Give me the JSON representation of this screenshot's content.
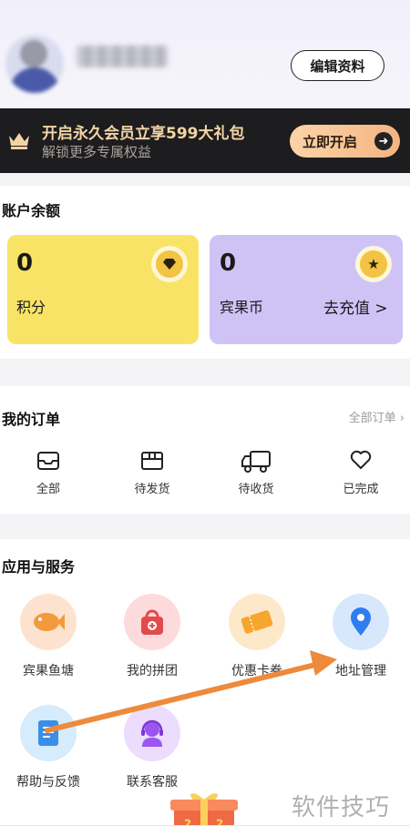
{
  "profile": {
    "edit_label": "编辑资料"
  },
  "vip": {
    "title": "开启永久会员立享599大礼包",
    "subtitle": "解锁更多专属权益",
    "cta": "立即开启"
  },
  "balance": {
    "title": "账户余额",
    "points": {
      "value": "0",
      "label": "积分"
    },
    "coins": {
      "value": "0",
      "label": "宾果币",
      "action": "去充值 >"
    }
  },
  "orders": {
    "title": "我的订单",
    "all_link": "全部订单 ›",
    "items": [
      {
        "label": "全部",
        "icon": "inbox-icon"
      },
      {
        "label": "待发货",
        "icon": "package-icon"
      },
      {
        "label": "待收货",
        "icon": "truck-icon"
      },
      {
        "label": "已完成",
        "icon": "heart-icon"
      }
    ]
  },
  "services": {
    "title": "应用与服务",
    "items": [
      {
        "label": "宾果鱼塘",
        "icon": "fish-icon"
      },
      {
        "label": "我的拼团",
        "icon": "shopping-bag-icon"
      },
      {
        "label": "优惠卡券",
        "icon": "coupon-icon"
      },
      {
        "label": "地址管理",
        "icon": "location-pin-icon"
      },
      {
        "label": "帮助与反馈",
        "icon": "document-icon"
      },
      {
        "label": "联系客服",
        "icon": "customer-service-icon"
      }
    ]
  },
  "watermark": "软件技巧",
  "colors": {
    "vip_gold": "#f3d5a4",
    "points_card": "#f8e366",
    "coins_card": "#cfc3f6",
    "annotation_arrow": "#ee8a3c"
  }
}
